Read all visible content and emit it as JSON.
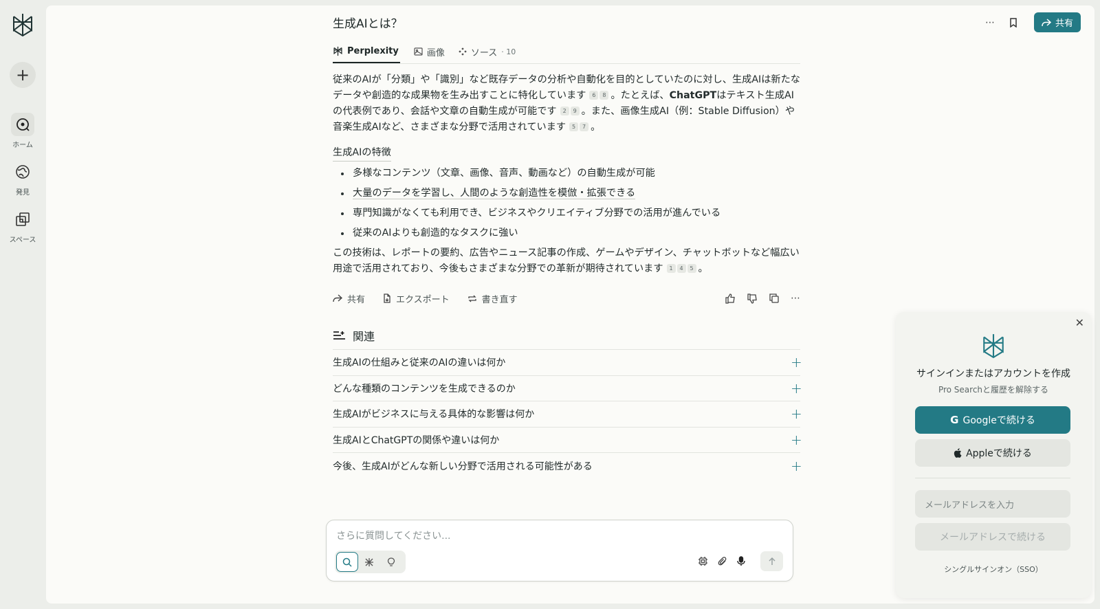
{
  "rail": {
    "items": [
      {
        "label": "ホーム"
      },
      {
        "label": "発見"
      },
      {
        "label": "スペース"
      }
    ]
  },
  "header": {
    "title": "生成AIとは？",
    "share_label": "共有"
  },
  "tabs": [
    {
      "label": "Perplexity"
    },
    {
      "label": "画像"
    },
    {
      "label": "ソース",
      "count": "· 10"
    }
  ],
  "answer": {
    "p1": {
      "a": "従来のAIが「分類」や「識別」など既存データの分析や自動化を目的としていたのに対し、生成AIは新たなデータや創造的な成果物を生み出すことに特化しています",
      "cites_a": [
        "6",
        "8"
      ],
      "b": "。たとえば、",
      "bold": "ChatGPT",
      "c": "はテキスト生成AIの代表例であり、会話や文章の自動生成が可能です",
      "cites_b": [
        "2",
        "9"
      ],
      "d": "。また、画像生成AI（例：Stable Diffusion）や音楽生成AIなど、さまざまな分野で活用されています",
      "cites_c": [
        "5",
        "7"
      ],
      "e": "。"
    },
    "section_heading": "生成AIの特徴",
    "bullets": [
      "多様なコンテンツ（文章、画像、音声、動画など）の自動生成が可能",
      "大量のデータを学習し、人間のような創造性を模倣・拡張できる",
      "専門知識がなくても利用でき、ビジネスやクリエイティブ分野での活用が進んでいる",
      "従来のAIよりも創造的なタスクに強い"
    ],
    "p2": {
      "a": "この技術は、レポートの要約、広告やニュース記事の作成、ゲームやデザイン、チャットボットなど幅広い用途で活用されており、今後もさまざまな分野での革新が期待されています",
      "cites": [
        "1",
        "4",
        "5"
      ],
      "b": "。"
    }
  },
  "actions": {
    "share": "共有",
    "export": "エクスポート",
    "rewrite": "書き直す"
  },
  "related": {
    "heading": "関連",
    "items": [
      "生成AIの仕組みと従来のAIの違いは何か",
      "どんな種類のコンテンツを生成できるのか",
      "生成AIがビジネスに与える具体的な影響は何か",
      "生成AIとChatGPTの関係や違いは何か",
      "今後、生成AIがどんな新しい分野で活用される可能性がある"
    ]
  },
  "ask": {
    "placeholder": "さらに質問してください..."
  },
  "signin": {
    "heading": "サインインまたはアカウントを作成",
    "sub": "Pro Searchと履歴を解除する",
    "google": "Googleで続ける",
    "apple": "Appleで続ける",
    "email_placeholder": "メールアドレスを入力",
    "email_continue": "メールアドレスで続ける",
    "sso": "シングルサインオン（SSO）"
  },
  "colors": {
    "accent": "#237a85",
    "background": "#eceeea",
    "surface": "#fbfbf8"
  }
}
